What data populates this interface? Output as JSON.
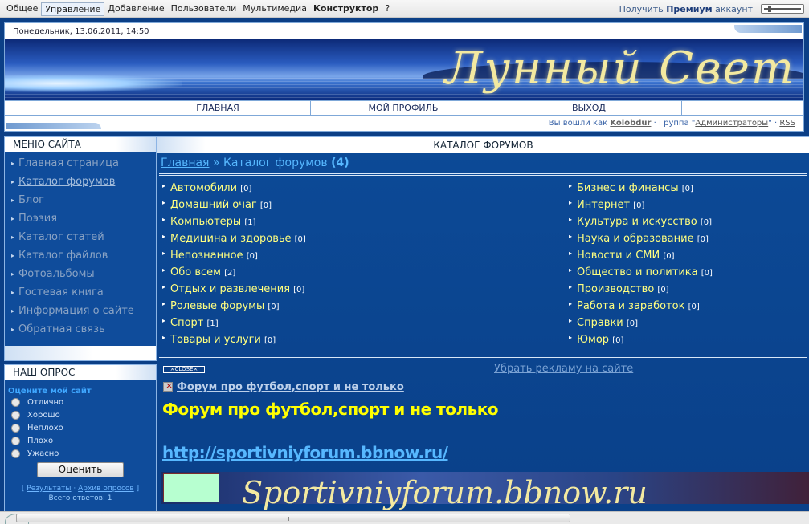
{
  "topbar": {
    "menu": [
      "Общее",
      "Управление",
      "Добавление",
      "Пользователи",
      "Мультимедиа",
      "Конструктор",
      "?"
    ],
    "premium_prefix": "Получить",
    "premium_bold": "Премиум",
    "premium_suffix": "аккаунт"
  },
  "header": {
    "date": "Понедельник, 13.06.2011, 14:50",
    "logo": "Лунный Свет",
    "nav": [
      "ГЛАВНАЯ",
      "МОЙ ПРОФИЛЬ",
      "ВЫХОД"
    ],
    "login_prefix": "Вы вошли как",
    "username": "Kolobdur",
    "group_prefix": "· Группа \"",
    "group": "Администраторы",
    "group_suffix": "\" ·",
    "rss": "RSS"
  },
  "sidebar": {
    "menu_title": "МЕНЮ САЙТА",
    "items": [
      "Главная страница",
      "Каталог форумов",
      "Блог",
      "Поэзия",
      "Каталог статей",
      "Каталог файлов",
      "Фотоальбомы",
      "Гостевая книга",
      "Информация о сайте",
      "Обратная связь"
    ],
    "poll_title": "НАШ ОПРОС",
    "poll_question": "Оцените мой сайт",
    "poll_options": [
      "Отлично",
      "Хорошо",
      "Неплохо",
      "Плохо",
      "Ужасно"
    ],
    "poll_button": "Оценить",
    "poll_results": "Результаты",
    "poll_archive": "Архив опросов",
    "poll_total": "Всего ответов: 1"
  },
  "main": {
    "title": "КАТАЛОГ ФОРУМОВ",
    "crumb_home": "Главная",
    "crumb_sep": "»",
    "crumb_current": "Каталог форумов",
    "crumb_count": "(4)",
    "left_categories": [
      {
        "name": "Автомобили",
        "count": "[0]"
      },
      {
        "name": "Домашний очаг",
        "count": "[0]"
      },
      {
        "name": "Компьютеры",
        "count": "[1]"
      },
      {
        "name": "Медицина и здоровье",
        "count": "[0]"
      },
      {
        "name": "Непознанное",
        "count": "[0]"
      },
      {
        "name": "Обо всем",
        "count": "[2]"
      },
      {
        "name": "Отдых и развлечения",
        "count": "[0]"
      },
      {
        "name": "Ролевые форумы",
        "count": "[0]"
      },
      {
        "name": "Спорт",
        "count": "[1]"
      },
      {
        "name": "Товары и услуги",
        "count": "[0]"
      }
    ],
    "right_categories": [
      {
        "name": "Бизнес и финансы",
        "count": "[0]"
      },
      {
        "name": "Интернет",
        "count": "[0]"
      },
      {
        "name": "Культура и искусство",
        "count": "[0]"
      },
      {
        "name": "Наука и образование",
        "count": "[0]"
      },
      {
        "name": "Новости и СМИ",
        "count": "[0]"
      },
      {
        "name": "Общество и политика",
        "count": "[0]"
      },
      {
        "name": "Производство",
        "count": "[0]"
      },
      {
        "name": "Работа и заработок",
        "count": "[0]"
      },
      {
        "name": "Справки",
        "count": "[0]"
      },
      {
        "name": "Юмор",
        "count": "[0]"
      }
    ]
  },
  "ads": {
    "close_label": "×CLOSE×",
    "remove": "Убрать рекламу на сайте",
    "link": "Форум про футбол,спорт и не только",
    "title": "Форум про футбол,спорт и не только",
    "url": "http://sportivniyforum.bbnow.ru/",
    "banner_text": "Sportivniyforum.bbnow.ru"
  }
}
